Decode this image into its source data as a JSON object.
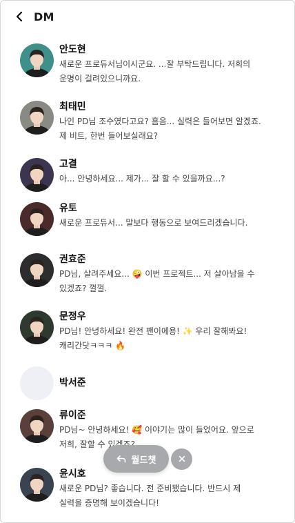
{
  "header": {
    "title": "DM",
    "back_icon": "chevron-left-icon"
  },
  "dms": [
    {
      "name": "안도현",
      "message": "새로운 프로듀서님이시군요. ...잘 부탁드립니다. 저희의 운명이 걸려있으니까요.",
      "avatar_icon": "avatar-portrait-icon",
      "avatar_color": "#3f8f8a"
    },
    {
      "name": "최태민",
      "message": "나인 PD님 조수였다고요? 흠음... 실력은 들어보면 알겠죠. 제 비트, 한번 들어보실래요?",
      "avatar_icon": "avatar-portrait-icon",
      "avatar_color": "#8a8a84"
    },
    {
      "name": "고결",
      "message": "아... 안녕하세요... 제가... 잘 할 수 있을까요...?",
      "avatar_icon": "avatar-portrait-icon",
      "avatar_color": "#3b3550"
    },
    {
      "name": "유토",
      "message": "새로운 프로듀서... 말보다 행동으로 보여드리겠습니다.",
      "avatar_icon": "avatar-portrait-icon",
      "avatar_color": "#4a2a2a"
    },
    {
      "name": "권효준",
      "message": "PD님, 살려주세요... 🤪 이번 프로젝트... 저 살아남을 수 있겠죠? 껄껄.",
      "avatar_icon": "avatar-portrait-icon",
      "avatar_color": "#2d2d2d"
    },
    {
      "name": "문정우",
      "message": "PD님! 안녕하세요! 완전 팬이에용! ✨ 우리 잘해봐요! 캐리간닷ㅋㅋㅋ 🔥",
      "avatar_icon": "avatar-portrait-icon",
      "avatar_color": "#2e3a2f"
    },
    {
      "name": "박서준",
      "message": "",
      "avatar_icon": "avatar-placeholder-icon",
      "avatar_color": "#eef0f5"
    },
    {
      "name": "류이준",
      "message": "PD님~ 안녕하세요! 🥰 이야기는 많이 들었어요. 앞으로 저희, 잘할 수 있겠죠?",
      "avatar_icon": "avatar-portrait-icon",
      "avatar_color": "#5a3f3a"
    },
    {
      "name": "윤시호",
      "message": "새로운 PD님? 좋습니다. 전 준비됐습니다. 반드시 제 실력을 증명해 보이겠습니다!",
      "avatar_icon": "avatar-portrait-icon",
      "avatar_color": "#3a4450"
    }
  ],
  "floating": {
    "worldchat_label": "월드챗",
    "worldchat_icon": "reply-arrow-icon",
    "close_icon": "close-icon",
    "button_color": "#a7a9ad"
  }
}
